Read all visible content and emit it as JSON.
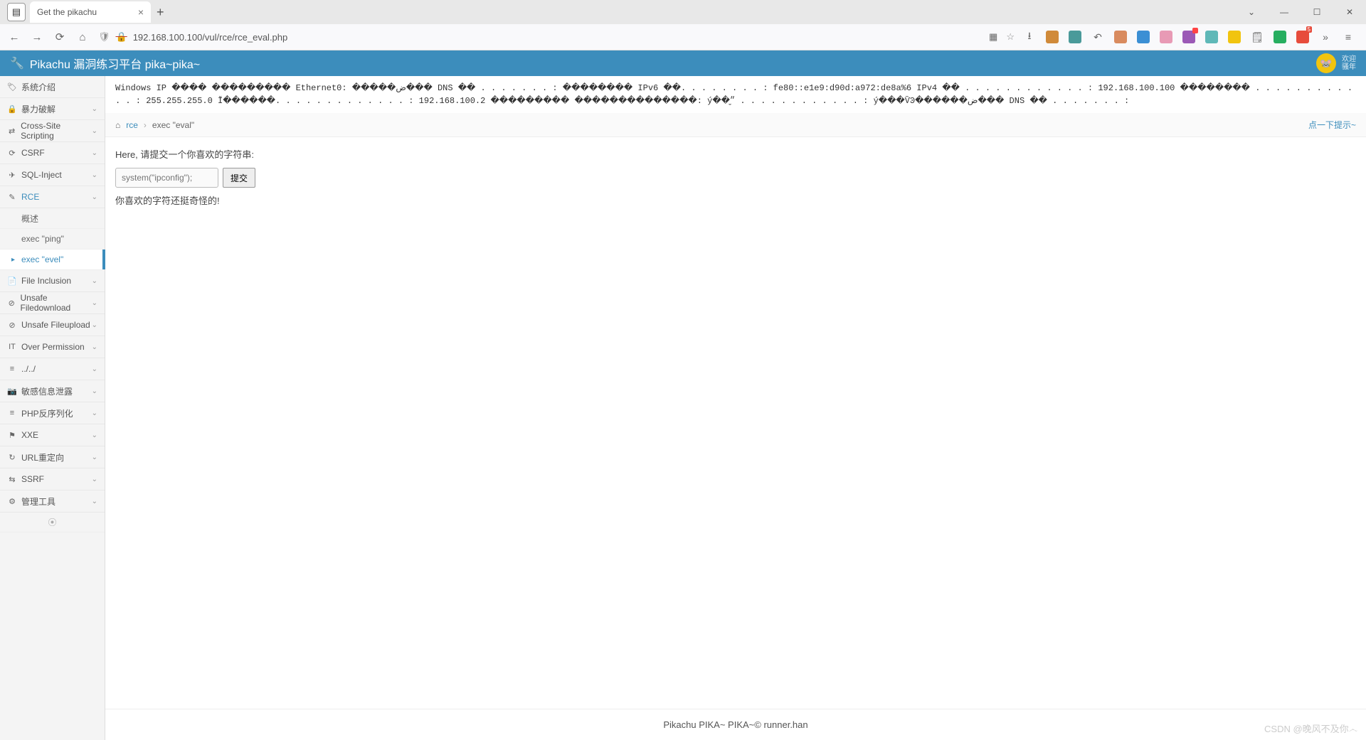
{
  "browser": {
    "tab_title": "Get the pikachu",
    "url": "192.168.100.100/vul/rce/rce_eval.php",
    "new_tab": "+",
    "close": "×",
    "chevron": "⌄",
    "min": "—",
    "max": "☐",
    "x": "✕",
    "more": "»"
  },
  "header": {
    "title": "Pikachu 漏洞练习平台 pika~pika~",
    "welcome_l1": "欢迎",
    "welcome_l2": "骚年"
  },
  "sidebar": {
    "items": [
      {
        "icon": "🏷",
        "label": "系统介绍",
        "chev": ""
      },
      {
        "icon": "🔒",
        "label": "暴力破解",
        "chev": "⌄"
      },
      {
        "icon": "⇄",
        "label": "Cross-Site Scripting",
        "chev": "⌄"
      },
      {
        "icon": "⟳",
        "label": "CSRF",
        "chev": "⌄"
      },
      {
        "icon": "✈",
        "label": "SQL-Inject",
        "chev": "⌄"
      },
      {
        "icon": "✎",
        "label": "RCE",
        "chev": "⌄"
      },
      {
        "icon": "📄",
        "label": "File Inclusion",
        "chev": "⌄"
      },
      {
        "icon": "⊘",
        "label": "Unsafe Filedownload",
        "chev": "⌄"
      },
      {
        "icon": "⊘",
        "label": "Unsafe Fileupload",
        "chev": "⌄"
      },
      {
        "icon": "IT",
        "label": "Over Permission",
        "chev": "⌄"
      },
      {
        "icon": "≡",
        "label": "../../",
        "chev": "⌄"
      },
      {
        "icon": "📷",
        "label": "敏感信息泄露",
        "chev": "⌄"
      },
      {
        "icon": "≡",
        "label": "PHP反序列化",
        "chev": "⌄"
      },
      {
        "icon": "⚑",
        "label": "XXE",
        "chev": "⌄"
      },
      {
        "icon": "↻",
        "label": "URL重定向",
        "chev": "⌄"
      },
      {
        "icon": "⇆",
        "label": "SSRF",
        "chev": "⌄"
      },
      {
        "icon": "⚙",
        "label": "管理工具",
        "chev": "⌄"
      }
    ],
    "rce_sub": [
      "概述",
      "exec \"ping\"",
      "exec \"evel\""
    ],
    "collapse": "⦿"
  },
  "raw": "Windows IP ���� ��������� Ethernet0: �����ض��� DNS ��׺ . . . . . . . : �������� IPv6 ��. . . . . . . . : fe80::e1e9:d90d:a972:de8a%6 IPv4 �� . . . . . . . . . . . . : 192.168.100.100 �������� . . . . . . . . . . . . : 255.255.255.0 Ĭ������. . . . . . . . . . . . . : 192.168.100.2 ��������� ��������������: ý��״̬ . . . . . . . . . . . . : ý���ѶϿ������ض��� DNS ��׺ . . . . . . . :",
  "breadcrumb": {
    "home": "⌂",
    "rce": "rce",
    "current": "exec \"eval\"",
    "hint": "点一下提示~"
  },
  "page": {
    "prompt": "Here, 请提交一个你喜欢的字符串:",
    "placeholder": "system(\"ipconfig\");",
    "submit": "提交",
    "result": "你喜欢的字符还挺奇怪的!"
  },
  "footer": "Pikachu PIKA~ PIKA~© runner.han",
  "watermark": "CSDN @晚风不及你෴"
}
